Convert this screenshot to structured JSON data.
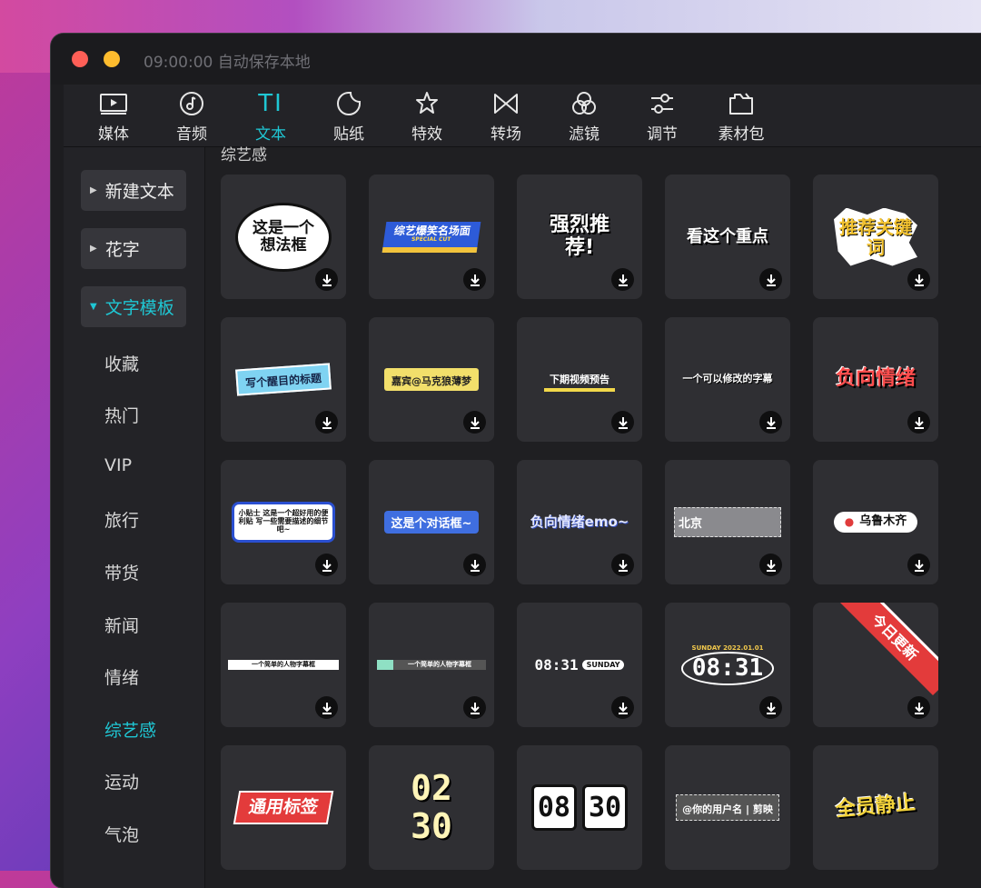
{
  "window": {
    "title": "09:00:00 自动保存本地"
  },
  "toolbar": [
    {
      "label": "媒体",
      "icon": "media-icon",
      "active": false
    },
    {
      "label": "音频",
      "icon": "audio-icon",
      "active": false
    },
    {
      "label": "文本",
      "icon": "text-icon",
      "active": true
    },
    {
      "label": "贴纸",
      "icon": "sticker-icon",
      "active": false
    },
    {
      "label": "特效",
      "icon": "effects-icon",
      "active": false
    },
    {
      "label": "转场",
      "icon": "transition-icon",
      "active": false
    },
    {
      "label": "滤镜",
      "icon": "filter-icon",
      "active": false
    },
    {
      "label": "调节",
      "icon": "adjust-icon",
      "active": false
    },
    {
      "label": "素材包",
      "icon": "material-pack-icon",
      "active": false
    }
  ],
  "text_icon_glyph": "TI",
  "sidebar": {
    "buttons": [
      {
        "label": "新建文本",
        "active": false
      },
      {
        "label": "花字",
        "active": false
      },
      {
        "label": "文字模板",
        "active": true
      }
    ],
    "items": [
      {
        "label": "收藏",
        "active": false
      },
      {
        "label": "热门",
        "active": false
      },
      {
        "label": "VIP",
        "active": false
      },
      {
        "label": "旅行",
        "active": false
      },
      {
        "label": "带货",
        "active": false
      },
      {
        "label": "新闻",
        "active": false
      },
      {
        "label": "情绪",
        "active": false
      },
      {
        "label": "综艺感",
        "active": true
      },
      {
        "label": "运动",
        "active": false
      },
      {
        "label": "气泡",
        "active": false
      }
    ]
  },
  "section_title": "综艺感",
  "templates": [
    {
      "text": "这是一个想法框"
    },
    {
      "text": "综艺爆笑名场面",
      "sub": "SPECIAL CUT"
    },
    {
      "text": "强烈推荐!"
    },
    {
      "text": "看这个重点"
    },
    {
      "text": "推荐关键词"
    },
    {
      "text": "写个醒目的标题"
    },
    {
      "text": "嘉宾@马克狼薄梦"
    },
    {
      "text": "下期视频预告"
    },
    {
      "text": "一个可以修改的字幕"
    },
    {
      "text": "负向情绪"
    },
    {
      "text": "小贴士 这是一个超好用的便利贴 写一些需要描述的细节吧~"
    },
    {
      "text": "这是个对话框~"
    },
    {
      "text": "负向情绪emo~"
    },
    {
      "text": "北京"
    },
    {
      "text": "乌鲁木齐"
    },
    {
      "text": "一个简单的人物字幕框"
    },
    {
      "text": "一个简单的人物字幕框"
    },
    {
      "text": "08:31",
      "sub": "SUNDAY"
    },
    {
      "text": "08:31",
      "sub": "SUNDAY 2022.01.01"
    },
    {
      "text": "今日更新"
    },
    {
      "text": "通用标签"
    },
    {
      "text": "02 30"
    },
    {
      "text": "08 30"
    },
    {
      "text": "@你的用户名 | 剪映"
    },
    {
      "text": "全员静止"
    }
  ],
  "colors": {
    "accent": "#1fc7d4",
    "panel": "#232327",
    "card": "#2f2f33"
  }
}
